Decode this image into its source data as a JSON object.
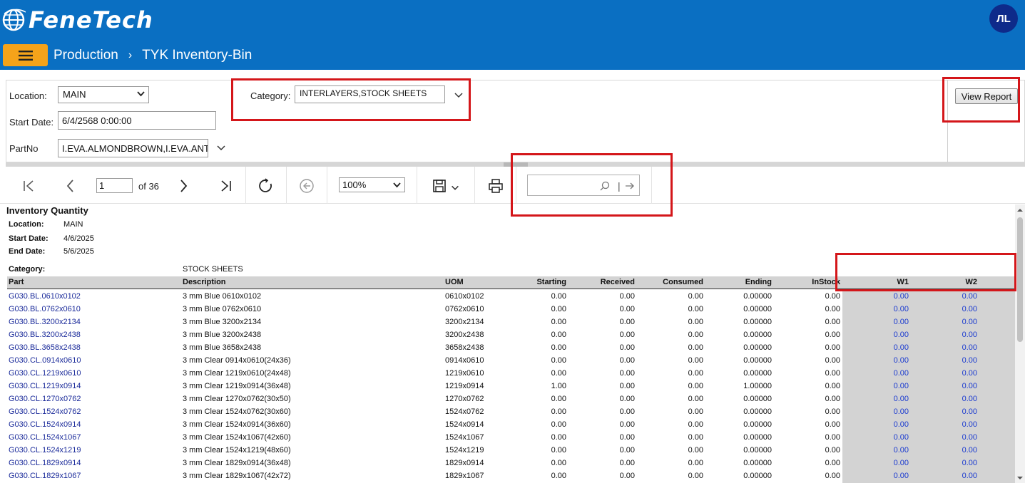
{
  "header": {
    "brand": "FeneTech",
    "avatar_initials": "ЛL",
    "breadcrumb": [
      "Production",
      "TYK Inventory-Bin"
    ]
  },
  "params": {
    "location_label": "Location:",
    "location_value": "MAIN",
    "category_label": "Category:",
    "category_value": "INTERLAYERS,STOCK SHEETS",
    "start_date_label": "Start Date:",
    "start_date_value": "6/4/2568 0:00:00",
    "partno_label": "PartNo",
    "partno_value": "I.EVA.ALMONDBROWN,I.EVA.ANTI",
    "view_report_label": "View Report"
  },
  "toolbar": {
    "page_current": "1",
    "page_of": "of 36",
    "zoom": "100%",
    "search_placeholder": ""
  },
  "report": {
    "title": "Inventory Quantity",
    "location_label": "Location:",
    "location_value": "MAIN",
    "start_date_label": "Start Date:",
    "start_date_value": "4/6/2025",
    "end_date_label": "End Date:",
    "end_date_value": "5/6/2025",
    "category_label": "Category:",
    "category_value": "STOCK SHEETS",
    "columns": [
      "Part",
      "Description",
      "UOM",
      "Starting",
      "Received",
      "Consumed",
      "Ending",
      "InStock",
      "W1",
      "W2"
    ],
    "rows": [
      [
        "G030.BL.0610x0102",
        "3 mm Blue 0610x0102",
        "0610x0102",
        "0.00",
        "0.00",
        "0.00",
        "0.00000",
        "0.00",
        "0.00",
        "0.00"
      ],
      [
        "G030.BL.0762x0610",
        "3 mm Blue 0762x0610",
        "0762x0610",
        "0.00",
        "0.00",
        "0.00",
        "0.00000",
        "0.00",
        "0.00",
        "0.00"
      ],
      [
        "G030.BL.3200x2134",
        "3 mm Blue 3200x2134",
        "3200x2134",
        "0.00",
        "0.00",
        "0.00",
        "0.00000",
        "0.00",
        "0.00",
        "0.00"
      ],
      [
        "G030.BL.3200x2438",
        "3 mm Blue 3200x2438",
        "3200x2438",
        "0.00",
        "0.00",
        "0.00",
        "0.00000",
        "0.00",
        "0.00",
        "0.00"
      ],
      [
        "G030.BL.3658x2438",
        "3 mm Blue 3658x2438",
        "3658x2438",
        "0.00",
        "0.00",
        "0.00",
        "0.00000",
        "0.00",
        "0.00",
        "0.00"
      ],
      [
        "G030.CL.0914x0610",
        "3 mm Clear 0914x0610(24x36)",
        "0914x0610",
        "0.00",
        "0.00",
        "0.00",
        "0.00000",
        "0.00",
        "0.00",
        "0.00"
      ],
      [
        "G030.CL.1219x0610",
        "3 mm Clear 1219x0610(24x48)",
        "1219x0610",
        "0.00",
        "0.00",
        "0.00",
        "0.00000",
        "0.00",
        "0.00",
        "0.00"
      ],
      [
        "G030.CL.1219x0914",
        "3 mm Clear 1219x0914(36x48)",
        "1219x0914",
        "1.00",
        "0.00",
        "0.00",
        "1.00000",
        "0.00",
        "0.00",
        "0.00"
      ],
      [
        "G030.CL.1270x0762",
        "3 mm Clear 1270x0762(30x50)",
        "1270x0762",
        "0.00",
        "0.00",
        "0.00",
        "0.00000",
        "0.00",
        "0.00",
        "0.00"
      ],
      [
        "G030.CL.1524x0762",
        "3 mm Clear 1524x0762(30x60)",
        "1524x0762",
        "0.00",
        "0.00",
        "0.00",
        "0.00000",
        "0.00",
        "0.00",
        "0.00"
      ],
      [
        "G030.CL.1524x0914",
        "3 mm Clear 1524x0914(36x60)",
        "1524x0914",
        "0.00",
        "0.00",
        "0.00",
        "0.00000",
        "0.00",
        "0.00",
        "0.00"
      ],
      [
        "G030.CL.1524x1067",
        "3 mm Clear 1524x1067(42x60)",
        "1524x1067",
        "0.00",
        "0.00",
        "0.00",
        "0.00000",
        "0.00",
        "0.00",
        "0.00"
      ],
      [
        "G030.CL.1524x1219",
        "3 mm Clear 1524x1219(48x60)",
        "1524x1219",
        "0.00",
        "0.00",
        "0.00",
        "0.00000",
        "0.00",
        "0.00",
        "0.00"
      ],
      [
        "G030.CL.1829x0914",
        "3 mm Clear 1829x0914(36x48)",
        "1829x0914",
        "0.00",
        "0.00",
        "0.00",
        "0.00000",
        "0.00",
        "0.00",
        "0.00"
      ],
      [
        "G030.CL.1829x1067",
        "3 mm Clear 1829x1067(42x72)",
        "1829x1067",
        "0.00",
        "0.00",
        "0.00",
        "0.00000",
        "0.00",
        "0.00",
        "0.00"
      ]
    ]
  },
  "colors": {
    "topbar": "#0a6fc2",
    "menu_button": "#f5a31a",
    "highlight": "#d4161a",
    "link": "#1a2a9a"
  }
}
